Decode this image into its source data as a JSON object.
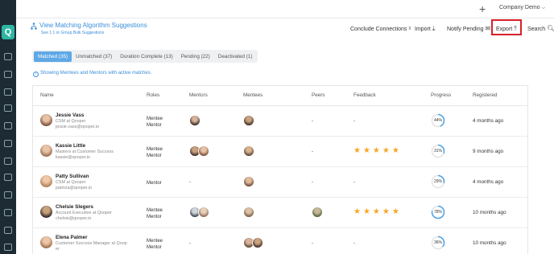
{
  "topbar": {
    "plus": "+",
    "company": "Company Demo",
    "chevron": "⌵"
  },
  "sidebar": {
    "logo": "Q"
  },
  "header": {
    "title": "View Matching Algorithm Suggestions",
    "subtitle": "See 1:1 or Group Bulk Suggestions",
    "actions": {
      "conclude": {
        "label": "Conclude Connections",
        "icon": "ᵡ"
      },
      "import": {
        "label": "Import",
        "icon": "⤓"
      },
      "notify": {
        "label": "Notify Pending",
        "icon": "✉"
      },
      "export": {
        "label": "Export",
        "icon": "⤒"
      },
      "search": {
        "label": "Search",
        "icon": "🔍︎"
      }
    }
  },
  "tabs": [
    {
      "label": "Matched (35)",
      "active": true
    },
    {
      "label": "Unmatched (37)"
    },
    {
      "label": "Duration Complete (13)"
    },
    {
      "label": "Pending (22)"
    },
    {
      "label": "Deactivated (1)"
    }
  ],
  "info": {
    "icon": "i",
    "text": "Showing Mentees and Mentors with active matches."
  },
  "table": {
    "columns": {
      "name": "Name",
      "roles": "Roles",
      "mentors": "Mentors",
      "mentees": "Mentees",
      "peers": "Peers",
      "feedback": "Feedback",
      "progress": "Progress",
      "registered": "Registered"
    },
    "rows": [
      {
        "name": "Jessie Vass",
        "title": "CSM at Qooper",
        "email": "jessie.vass@qooper.io",
        "role1": "Mentee",
        "role2": "Mentor",
        "peers": "-",
        "feedback": "-",
        "stars": "",
        "progress": "44%",
        "progress_value": 0.44,
        "registered": "4 months ago",
        "mentors_count": 1,
        "mentees_count": 1,
        "peer_avatar": false
      },
      {
        "name": "Kassie Little",
        "title": "Masters at Customer Success",
        "email": "kassie@qooper.io",
        "role1": "Mentee",
        "role2": "Mentor",
        "peers": "-",
        "feedback": "",
        "stars": "★★★★★",
        "progress": "31%",
        "progress_value": 0.31,
        "registered": "9 months ago",
        "mentors_count": 2,
        "mentees_count": 1,
        "peer_avatar": false
      },
      {
        "name": "Patty Sullivan",
        "title": "CSM at Qooper",
        "email": "patricia@qooper.io",
        "role1": "Mentor",
        "role2": "",
        "mentors_dash": "-",
        "peers": "-",
        "feedback": "-",
        "stars": "",
        "progress": "29%",
        "progress_value": 0.29,
        "registered": "4 months ago",
        "mentors_count": 0,
        "mentees_count": 1,
        "peer_avatar": false
      },
      {
        "name": "Chelsie Slegers",
        "title": "Account Executive at Qooper",
        "email": "chelsie@qooper.io",
        "role1": "Mentee",
        "role2": "Mentor",
        "peers": "",
        "feedback": "",
        "stars": "★★★★★",
        "progress": "78%",
        "progress_value": 0.78,
        "registered": "10 months ago",
        "mentors_count": 2,
        "mentees_count": 1,
        "peer_avatar": true
      },
      {
        "name": "Elena Palmer",
        "title": "Customer Success Manager at Qoop",
        "title2": "er",
        "role1": "Mentee",
        "role2": "Mentor",
        "mentors_dash": "-",
        "peers": "-",
        "feedback": "-",
        "stars": "",
        "progress": "36%",
        "progress_value": 0.36,
        "registered": "10 months ago",
        "mentors_count": 0,
        "mentees_count": 2,
        "peer_avatar": false
      }
    ]
  },
  "colors": {
    "accent": "#3b8fd9",
    "sidebar": "#1c2b34",
    "logo": "#2db6a3",
    "star": "#f5a623",
    "highlight": "#d6202a"
  }
}
